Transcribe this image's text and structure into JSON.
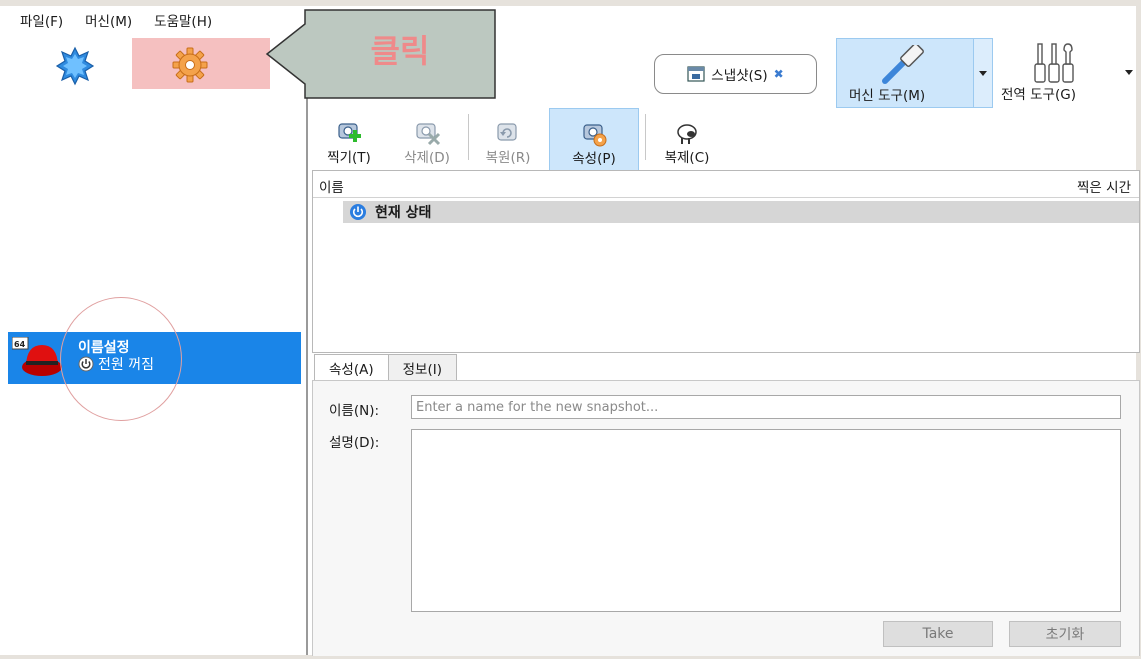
{
  "menu": [
    "파일(F)",
    "머신(M)",
    "도움말(H)"
  ],
  "callout": {
    "text": "클릭"
  },
  "vm": {
    "name": "이름설정",
    "status": "전원 꺼짐",
    "badge": "64"
  },
  "toolbar_right": {
    "snapshot": "스냅샷(S)",
    "machine_tools": "머신 도구(M)",
    "global_tools": "전역 도구(G)"
  },
  "snap_toolbar": [
    {
      "label": "찍기(T)",
      "state": "enabled"
    },
    {
      "label": "삭제(D)",
      "state": "disabled"
    },
    {
      "label": "복원(R)",
      "state": "disabled"
    },
    {
      "label": "속성(P)",
      "state": "active"
    },
    {
      "label": "복제(C)",
      "state": "enabled"
    }
  ],
  "tree": {
    "col_name": "이름",
    "col_time": "찍은 시간",
    "current_state": "현재 상태"
  },
  "tabs": [
    "속성(A)",
    "정보(I)"
  ],
  "details": {
    "name_label": "이름(N):",
    "name_placeholder": "Enter a name for the new snapshot...",
    "desc_label": "설명(D):",
    "take": "Take",
    "reset": "초기화"
  },
  "colors": {
    "selection": "#1a85e8",
    "highlight": "#cde6fb",
    "callout_text": "#ef8a8a"
  }
}
